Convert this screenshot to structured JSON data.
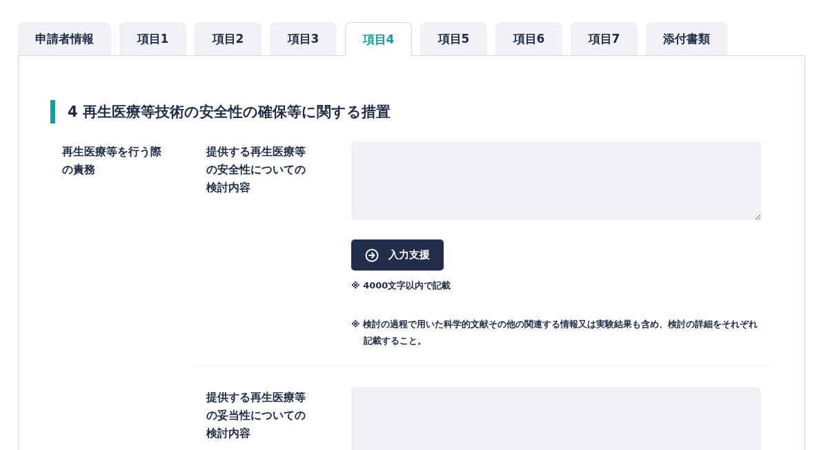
{
  "tabs": [
    {
      "label": "申請者情報",
      "selected": false
    },
    {
      "label": "項目1",
      "selected": false
    },
    {
      "label": "項目2",
      "selected": false
    },
    {
      "label": "項目3",
      "selected": false
    },
    {
      "label": "項目4",
      "selected": true
    },
    {
      "label": "項目5",
      "selected": false
    },
    {
      "label": "項目6",
      "selected": false
    },
    {
      "label": "項目7",
      "selected": false
    },
    {
      "label": "添付書類",
      "selected": false
    }
  ],
  "section": {
    "heading": "4 再生医療等技術の安全性の確保等に関する措置",
    "groups": [
      {
        "label": "再生医療等を行う際の責務",
        "fields": [
          {
            "label": "提供する再生医療等の安全性についての検討内容",
            "assist_button": "入力支援",
            "notes": [
              "※ 4000文字以内で記載",
              "※ 検討の過程で用いた科学的文献その他の関連する情報又は実験結果も含め、検討の詳細をそれぞれ記載すること。"
            ]
          },
          {
            "label": "提供する再生医療等の妥当性についての検討内容"
          }
        ]
      }
    ]
  }
}
